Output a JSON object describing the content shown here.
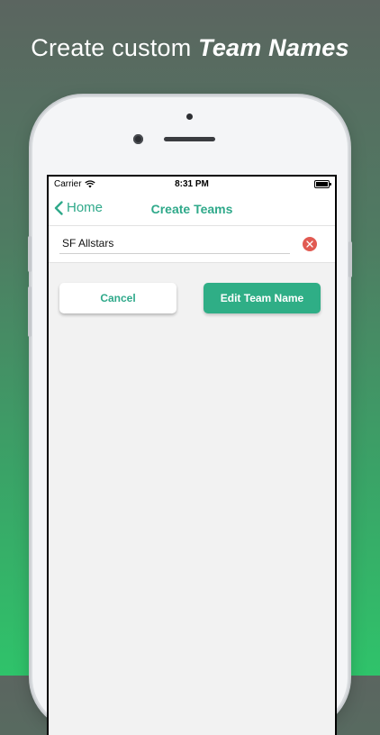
{
  "headline": {
    "prefix": "Create custom",
    "emphasis": "Team Names"
  },
  "status_bar": {
    "carrier": "Carrier",
    "time": "8:31 PM"
  },
  "navbar": {
    "back_label": "Home",
    "title": "Create Teams"
  },
  "form": {
    "team_name_value": "SF Allstars"
  },
  "actions": {
    "cancel_label": "Cancel",
    "edit_label": "Edit Team Name"
  },
  "colors": {
    "accent": "#2fa98a",
    "primary_button": "#2fae86",
    "clear_button": "#e15a52"
  }
}
